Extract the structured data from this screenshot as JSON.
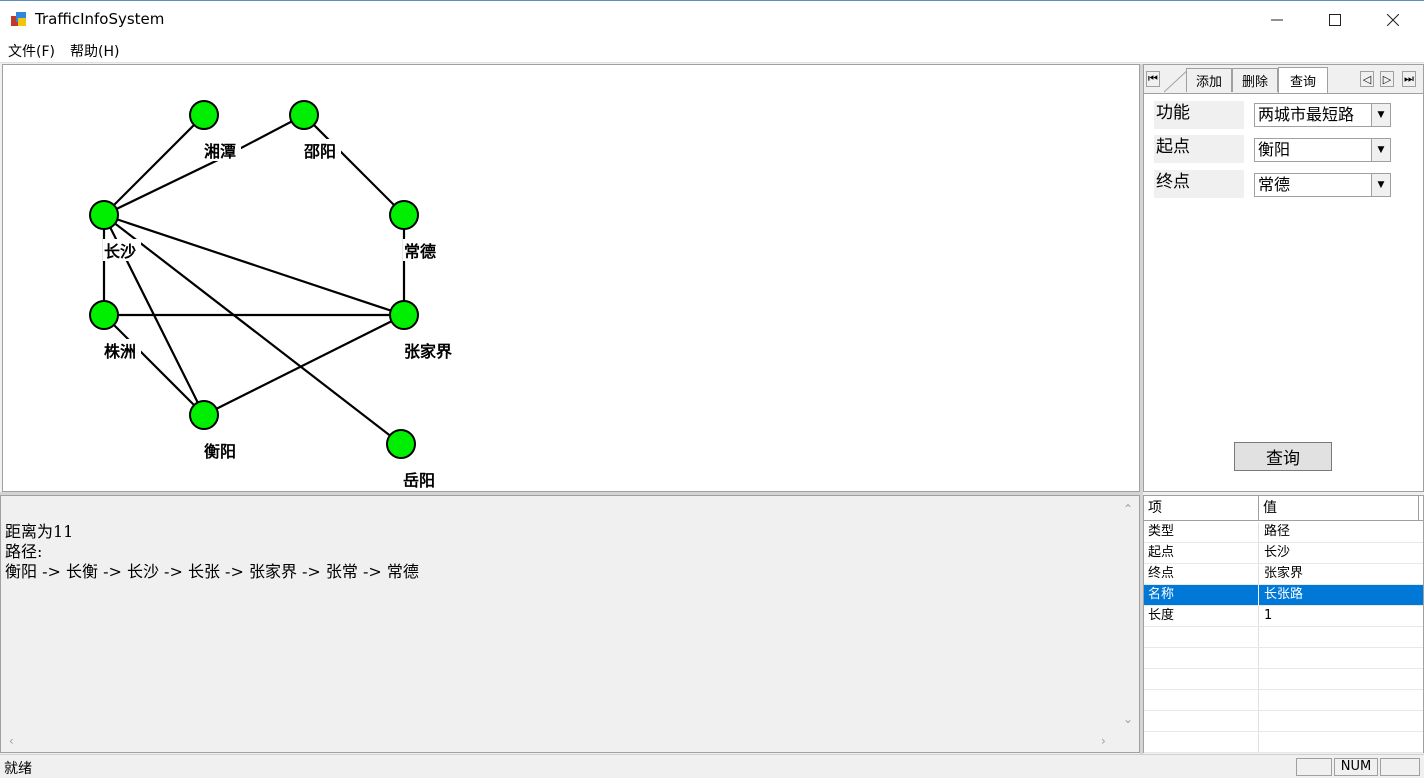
{
  "window": {
    "title": "TrafficInfoSystem"
  },
  "menu": [
    {
      "label": "文件(F)"
    },
    {
      "label": "帮助(H)"
    }
  ],
  "graph": {
    "nodes": [
      {
        "id": "xiangtan",
        "label": "湘潭"
      },
      {
        "id": "shaoyang",
        "label": "邵阳"
      },
      {
        "id": "changsha",
        "label": "长沙"
      },
      {
        "id": "changde",
        "label": "常德"
      },
      {
        "id": "zhuzhou",
        "label": "株洲"
      },
      {
        "id": "zhangjiajie",
        "label": "张家界"
      },
      {
        "id": "hengyang",
        "label": "衡阳"
      },
      {
        "id": "yueyang",
        "label": "岳阳"
      }
    ],
    "node_color": "#00ee00"
  },
  "tabs": [
    {
      "label": "添加"
    },
    {
      "label": "删除"
    },
    {
      "label": "查询"
    }
  ],
  "form": {
    "function_label": "功能",
    "function_value": "两城市最短路",
    "start_label": "起点",
    "start_value": "衡阳",
    "end_label": "终点",
    "end_value": "常德",
    "query_button": "查询"
  },
  "output": {
    "lines": [
      "距离为11",
      "路径:",
      "衡阳 -> 长衡 -> 长沙 -> 长张 -> 张家界 -> 张常 -> 常德"
    ]
  },
  "properties": {
    "header": {
      "item": "项",
      "value": "值"
    },
    "rows": [
      {
        "item": "类型",
        "value": "路径"
      },
      {
        "item": "起点",
        "value": "长沙"
      },
      {
        "item": "终点",
        "value": "张家界"
      },
      {
        "item": "名称",
        "value": "长张路"
      },
      {
        "item": "长度",
        "value": "1"
      }
    ],
    "selected_color": "#0078d7"
  },
  "status": {
    "text": "就绪",
    "num": "NUM"
  }
}
